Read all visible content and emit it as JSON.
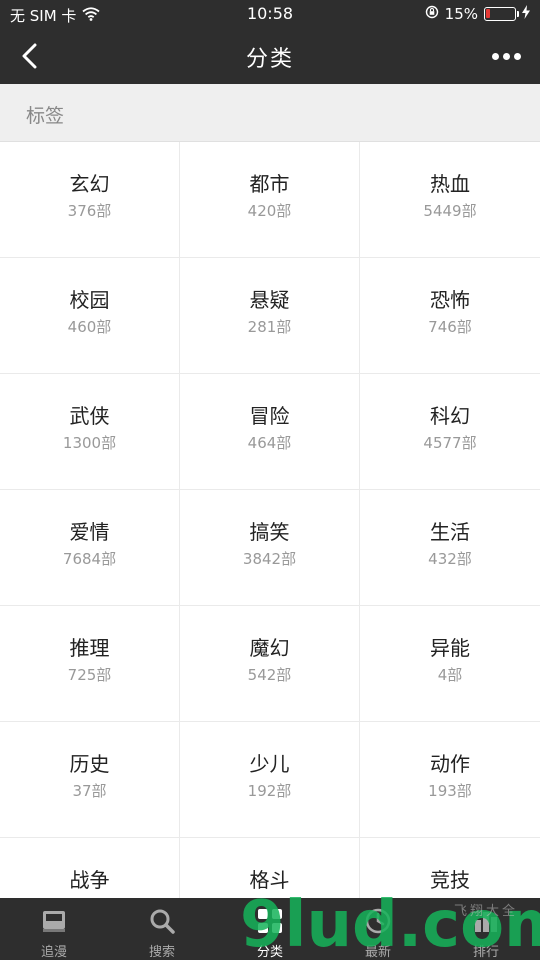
{
  "status_bar": {
    "carrier": "无 SIM 卡",
    "time": "10:58",
    "battery_percent_label": "15%",
    "battery_level": 0.15
  },
  "nav": {
    "title": "分类"
  },
  "section": {
    "label": "标签"
  },
  "categories": [
    {
      "name": "玄幻",
      "count": "376部"
    },
    {
      "name": "都市",
      "count": "420部"
    },
    {
      "name": "热血",
      "count": "5449部"
    },
    {
      "name": "校园",
      "count": "460部"
    },
    {
      "name": "悬疑",
      "count": "281部"
    },
    {
      "name": "恐怖",
      "count": "746部"
    },
    {
      "name": "武侠",
      "count": "1300部"
    },
    {
      "name": "冒险",
      "count": "464部"
    },
    {
      "name": "科幻",
      "count": "4577部"
    },
    {
      "name": "爱情",
      "count": "7684部"
    },
    {
      "name": "搞笑",
      "count": "3842部"
    },
    {
      "name": "生活",
      "count": "432部"
    },
    {
      "name": "推理",
      "count": "725部"
    },
    {
      "name": "魔幻",
      "count": "542部"
    },
    {
      "name": "异能",
      "count": "4部"
    },
    {
      "name": "历史",
      "count": "37部"
    },
    {
      "name": "少儿",
      "count": "192部"
    },
    {
      "name": "动作",
      "count": "193部"
    },
    {
      "name": "战争",
      "count": ""
    },
    {
      "name": "格斗",
      "count": ""
    },
    {
      "name": "竞技",
      "count": ""
    }
  ],
  "tabs": [
    {
      "label": "追漫",
      "icon": "book-icon",
      "active": false
    },
    {
      "label": "搜索",
      "icon": "search-icon",
      "active": false
    },
    {
      "label": "分类",
      "icon": "grid-icon",
      "active": true
    },
    {
      "label": "最新",
      "icon": "clock-icon",
      "active": false
    },
    {
      "label": "排行",
      "icon": "bar-chart-icon",
      "active": false
    }
  ],
  "watermark": {
    "text": "9lud.com",
    "subtext": "飞翔大全"
  },
  "colors": {
    "header_bg": "#2e2e2e",
    "section_bg": "#efefef",
    "battery_low": "#e53935",
    "watermark_green": "#16b35a",
    "watermark_orange": "#f39c12"
  }
}
